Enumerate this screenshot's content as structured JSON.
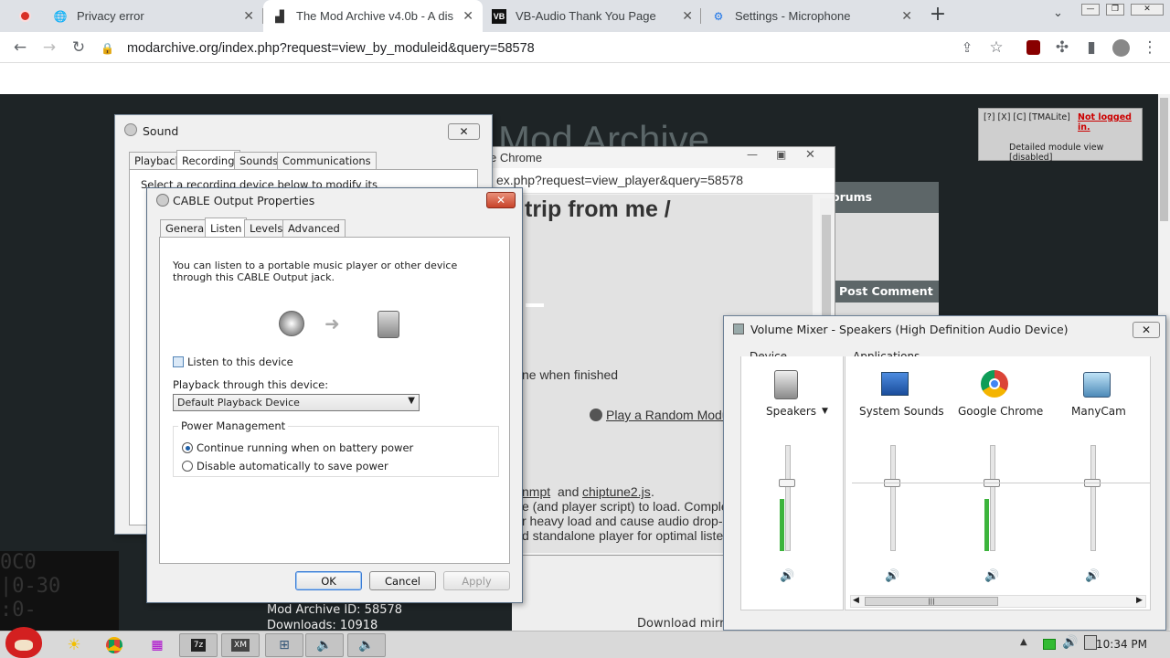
{
  "browser": {
    "tabs": [
      {
        "title": "Privacy error",
        "icon": "globe-icon"
      },
      {
        "title": "The Mod Archive v4.0b - A dis",
        "icon": "modarchive-icon"
      },
      {
        "title": "VB-Audio Thank You Page",
        "icon": "vb-icon"
      },
      {
        "title": "Settings - Microphone",
        "icon": "gear-icon"
      }
    ],
    "new_tab": "+",
    "url": "modarchive.org/index.php?request=view_by_moduleid&query=58578"
  },
  "page": {
    "site_title": "Mod Archive",
    "top_links": "[?] [X] [C] [TMALite]",
    "not_logged_in": "Not logged in.",
    "detailed_view": "Detailed module view [disabled]",
    "forums": "orums",
    "post_comment": "Post Comment",
    "heading": "trip from me /",
    "when_finished": "ne when finished",
    "random_module": "Play a Random Modu",
    "libs": {
      "lib1": "nmpt",
      "and": "and",
      "lib2": "chiptune2.js",
      "end": "."
    },
    "notes": [
      "e (and player script) to load. Comple",
      "r heavy load and cause audio drop-",
      "d standalone player for optimal listen"
    ],
    "mod_id": "Mod Archive ID: 58578",
    "downloads": "Downloads: 10918",
    "download_mirror": "Download mirro"
  },
  "popup_chrome": {
    "title": "e Chrome",
    "url": "ex.php?request=view_player&query=58578"
  },
  "sound_dialog": {
    "title": "Sound",
    "tabs": [
      "Playback",
      "Recording",
      "Sounds",
      "Communications"
    ],
    "selected_tab": "Recording",
    "hint": "Select a recording device below to modify its settings:"
  },
  "cable_dialog": {
    "title": "CABLE Output Properties",
    "tabs": [
      "General",
      "Listen",
      "Levels",
      "Advanced"
    ],
    "selected_tab": "Listen",
    "description": "You can listen to a portable music player or other device through this CABLE Output jack.",
    "listen_label": "Listen to this device",
    "listen_checked": false,
    "playback_label": "Playback through this device:",
    "playback_value": "Default Playback Device",
    "power_group": "Power Management",
    "power_options": [
      "Continue running when on battery power",
      "Disable automatically to save power"
    ],
    "power_selected": 0,
    "ok": "OK",
    "cancel": "Cancel",
    "apply": "Apply"
  },
  "volume_mixer": {
    "title": "Volume Mixer - Speakers (High Definition Audio Device)",
    "device_label": "Device",
    "apps_label": "Applications",
    "channels": [
      {
        "name": "Speakers",
        "icon": "speaker-icon",
        "volume": 0.68,
        "level": 0.55
      },
      {
        "name": "System Sounds",
        "icon": "system-sounds-icon",
        "volume": 0.68,
        "level": 0
      },
      {
        "name": "Google Chrome",
        "icon": "chrome-icon",
        "volume": 0.68,
        "level": 0.55
      },
      {
        "name": "ManyCam",
        "icon": "manycam-icon",
        "volume": 0.68,
        "level": 0
      }
    ]
  },
  "taskbar": {
    "items": [
      "angry-birds-icon",
      "sun-icon",
      "chrome-icon",
      "apps-icon",
      "7zip-icon",
      "xm-icon",
      "network-icon",
      "speaker-icon",
      "speaker-icon"
    ],
    "clock": "10:34 PM"
  }
}
